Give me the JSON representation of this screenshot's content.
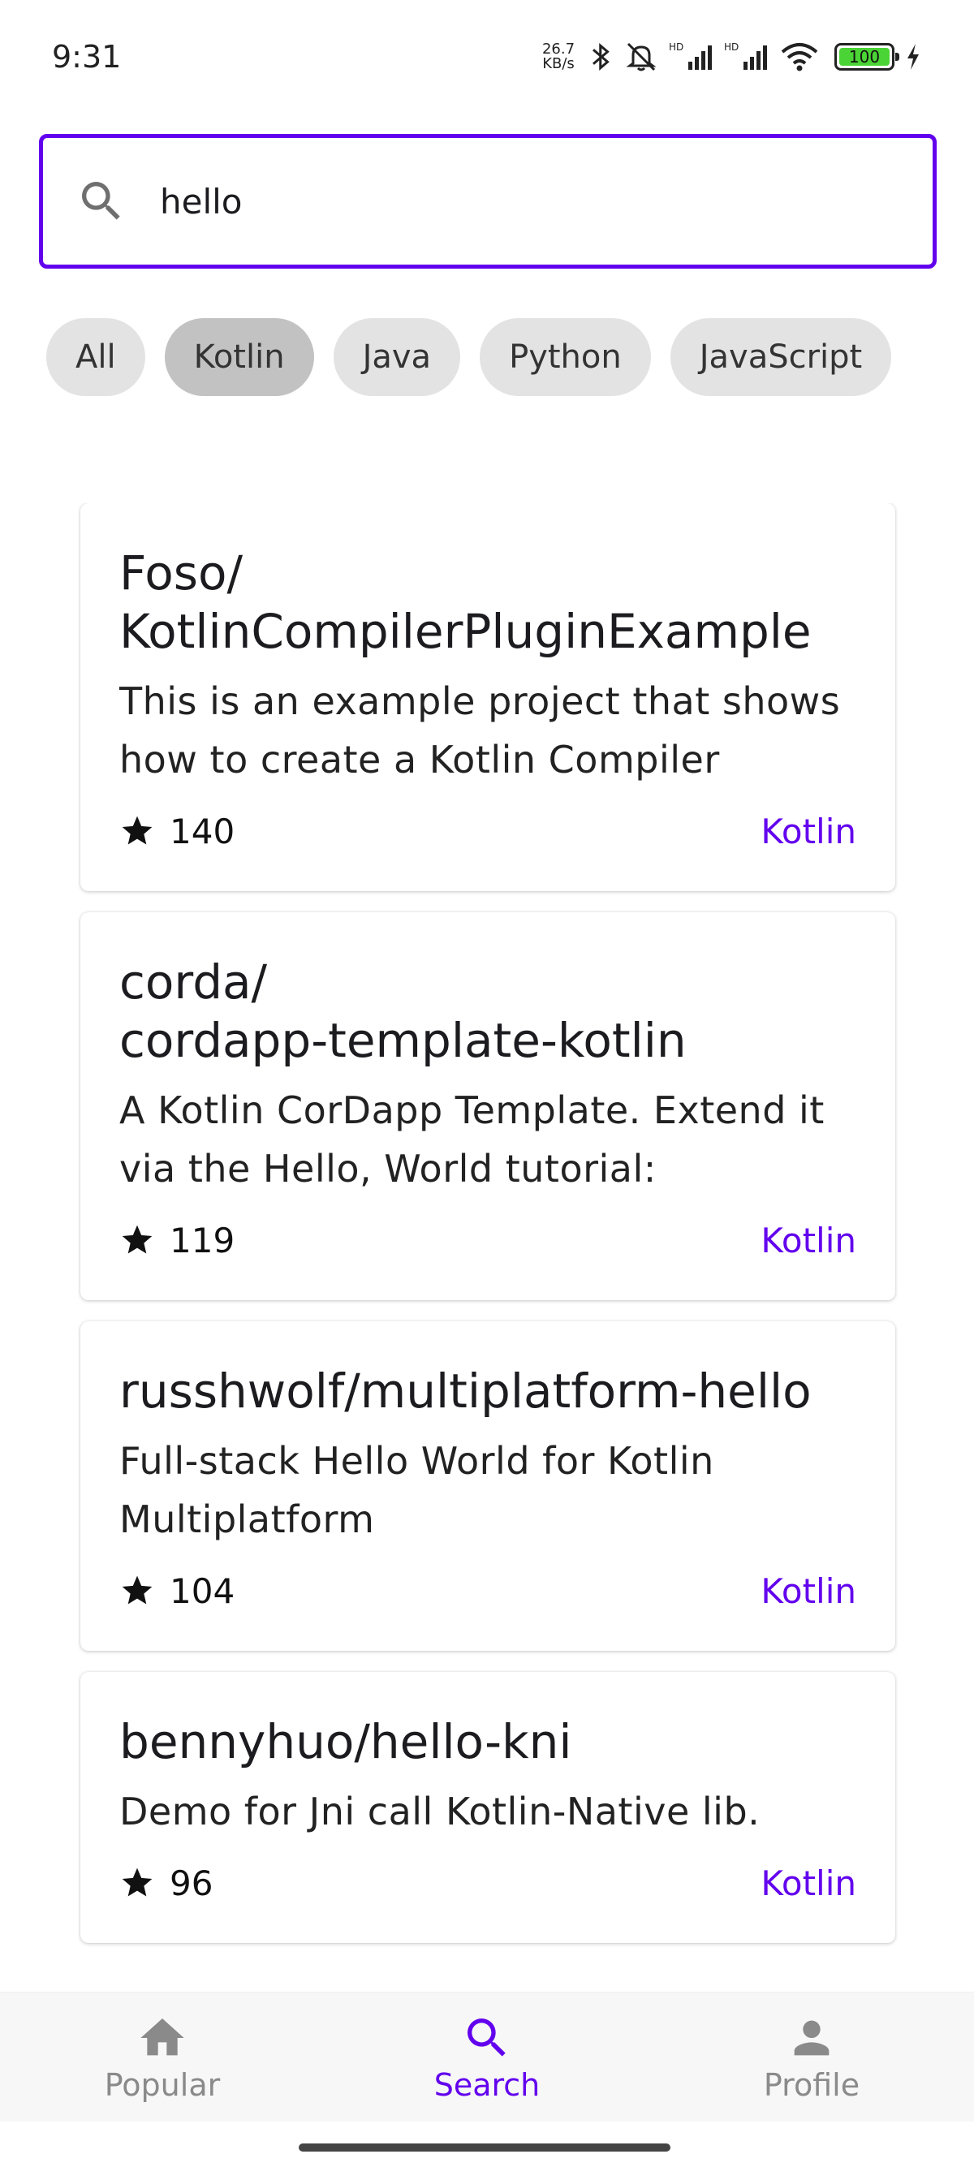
{
  "status_bar": {
    "time": "9:31",
    "net_speed": "26.7",
    "net_speed_unit": "KB/s",
    "battery": "100",
    "battery_level": 1.0
  },
  "search": {
    "value": "hello",
    "icon": "search-icon"
  },
  "chips": [
    {
      "label": "All",
      "selected": false
    },
    {
      "label": "Kotlin",
      "selected": true
    },
    {
      "label": "Java",
      "selected": false
    },
    {
      "label": "Python",
      "selected": false
    },
    {
      "label": "JavaScript",
      "selected": false
    }
  ],
  "results": [
    {
      "title": "Foso/\nKotlinCompilerPluginExample",
      "description": "This is an example project that shows how to create a Kotlin Compiler",
      "stars": "140",
      "language": "Kotlin"
    },
    {
      "title": "corda/\ncordapp-template-kotlin",
      "description": "A Kotlin CorDapp Template. Extend it via the Hello, World tutorial:",
      "stars": "119",
      "language": "Kotlin"
    },
    {
      "title": "russhwolf/multiplatform-hello",
      "description": "Full-stack Hello World for Kotlin Multiplatform",
      "stars": "104",
      "language": "Kotlin"
    },
    {
      "title": "bennyhuo/hello-kni",
      "description": "Demo for Jni call Kotlin-Native lib.",
      "stars": "96",
      "language": "Kotlin"
    }
  ],
  "bottom_nav": [
    {
      "label": "Popular",
      "icon": "home-icon",
      "active": false
    },
    {
      "label": "Search",
      "icon": "search-icon",
      "active": true
    },
    {
      "label": "Profile",
      "icon": "person-icon",
      "active": false
    }
  ],
  "colors": {
    "accent": "#6200ee",
    "chip": "#e3e3e3",
    "chip_selected": "#c2c2c2",
    "nav_inactive": "#8a8a8a"
  }
}
